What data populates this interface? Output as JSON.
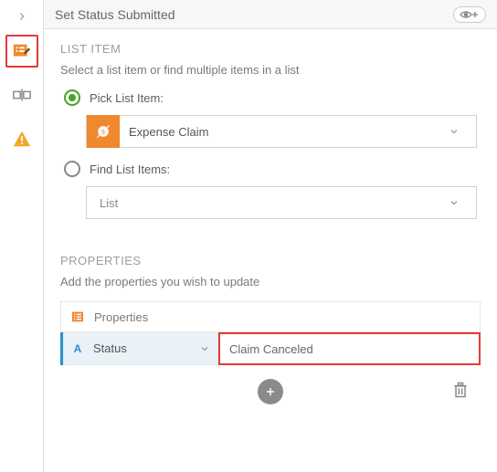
{
  "header": {
    "title": "Set Status Submitted"
  },
  "sidebar": {
    "items": [
      {
        "icon": "chevron-right"
      },
      {
        "icon": "list-edit",
        "selected": true
      },
      {
        "icon": "rename"
      },
      {
        "icon": "warning"
      }
    ]
  },
  "list_item": {
    "title": "LIST ITEM",
    "subtitle": "Select a list item or find multiple items in a list",
    "options": {
      "pick": {
        "label": "Pick List Item:",
        "checked": true,
        "value": "Expense Claim"
      },
      "find": {
        "label": "Find List Items:",
        "checked": false,
        "placeholder": "List"
      }
    }
  },
  "properties": {
    "title": "PROPERTIES",
    "subtitle": "Add the properties you wish to update",
    "header_label": "Properties",
    "rows": [
      {
        "key": "Status",
        "value": "Claim Canceled"
      }
    ]
  }
}
